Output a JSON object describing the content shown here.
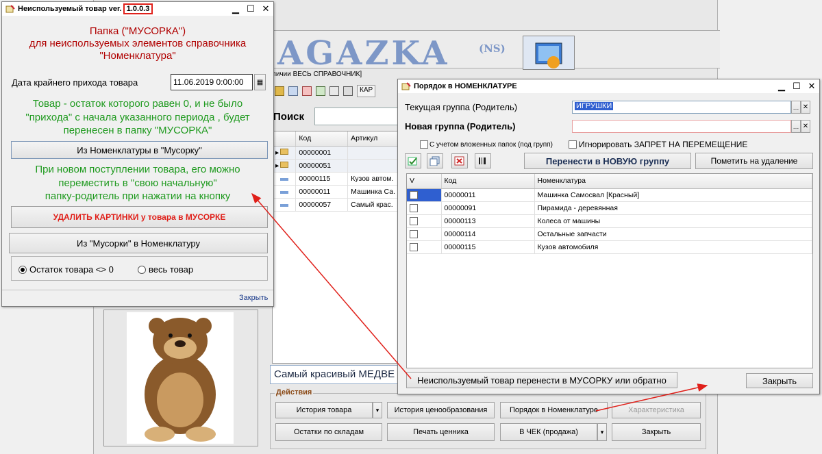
{
  "bg": {
    "logo_text": "AGAZKA",
    "logo_sup": "(NS)",
    "subtitle": "личии ВЕСЬ СПРАВОЧНИК]",
    "search_label": "Поиск",
    "table_headers": [
      "Код",
      "Артикул"
    ],
    "rows": [
      {
        "code": "00000001",
        "art": "",
        "type": "folder"
      },
      {
        "code": "00000051",
        "art": "",
        "type": "folder"
      },
      {
        "code": "00000115",
        "art": "Кузов автом.",
        "type": "item"
      },
      {
        "code": "00000011",
        "art": "Машинка Са.",
        "type": "item"
      },
      {
        "code": "00000057",
        "art": "Самый крас.",
        "type": "item"
      }
    ],
    "product_name": "Самый красивый МЕДВЕ",
    "actions_label": "Действия",
    "btn_history": "История товара",
    "btn_price_history": "История ценообразования",
    "btn_order": "Порядок в Номенклатуре",
    "btn_characteristics": "Характеристика",
    "btn_stock": "Остатки по складам",
    "btn_print_price": "Печать ценника",
    "btn_to_check": "В ЧЕК (продажа)",
    "btn_close": "Закрыть",
    "tb_label": "КАР"
  },
  "unused": {
    "title_prefix": "Неиспользуемый товар ver.",
    "version": "1.0.0.3",
    "heading1": "Папка (\"МУСОРКА\")",
    "heading2": "для неиспользуемых элементов справочника",
    "heading3": "\"Номенклатура\"",
    "date_label": "Дата крайнего прихода товара",
    "date_value": "11.06.2019  0:00:00",
    "info1": "Товар - остаток которого равен 0, и не было",
    "info2": "\"прихода\" с начала указанного периода , будет",
    "info3": "перенесен в папку \"МУСОРКА\"",
    "btn_to_trash": "Из Номенклатуры в \"Мусорку\"",
    "info4": "При новом поступлении товара, его можно",
    "info5": "переместить  в  \"свою начальную\"",
    "info6": "папку-родитель при нажатии на кнопку",
    "btn_delete_images": "УДАЛИТЬ КАРТИНКИ у товара в МУСОРКЕ",
    "btn_from_trash": "Из \"Мусорки\" в Номенклатуру",
    "radio1": "Остаток товара <> 0",
    "radio2": "весь товар",
    "close": "Закрыть"
  },
  "order": {
    "title": "Порядок в НОМЕНКЛАТУРЕ",
    "current_group_label": "Текущая группа (Родитель)",
    "current_group_value": "ИГРУШКИ",
    "new_group_label": "Новая группа (Родитель)",
    "new_group_value": "",
    "chk_nested": "С учетом вложенных папок (под групп)",
    "chk_ignore": "Игнорировать ЗАПРЕТ НА ПЕРЕМЕЩЕНИЕ",
    "btn_move": "Перенести в НОВУЮ группу",
    "btn_mark_delete": "Пометить на удаление",
    "col_v": "V",
    "col_code": "Код",
    "col_name": "Номенклатура",
    "items": [
      {
        "code": "00000011",
        "name": "Машинка Самосвал [Красный]"
      },
      {
        "code": "00000091",
        "name": "Пирамида - деревянная"
      },
      {
        "code": "00000113",
        "name": "Колеса от машины"
      },
      {
        "code": "00000114",
        "name": "Остальные запчасти"
      },
      {
        "code": "00000115",
        "name": "Кузов автомобиля"
      }
    ],
    "btn_unused": "Неиспользуемый товар перенести в МУСОРКУ или обратно",
    "btn_close": "Закрыть"
  },
  "colors": {
    "accent_red": "#e0201a",
    "selection_blue": "#2f5fd0",
    "green_text": "#1f9a1f",
    "dark_red_text": "#b00000"
  }
}
